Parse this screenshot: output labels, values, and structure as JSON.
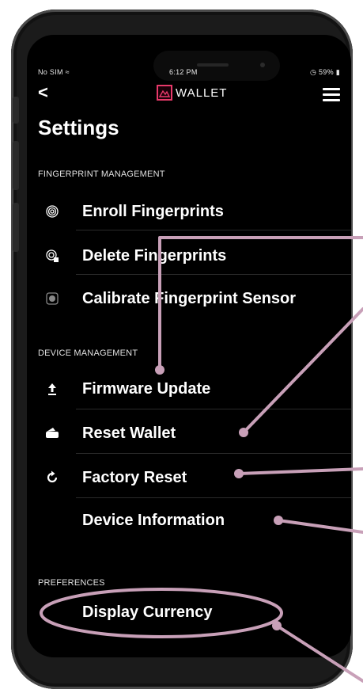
{
  "status": {
    "carrier": "No SIM",
    "wifi_icon": "wifi-icon",
    "time": "6:12 PM",
    "battery": "59%"
  },
  "header": {
    "back": "<",
    "brand": "WALLET",
    "logo_icon": "mountain-logo-icon",
    "menu_icon": "hamburger-menu-icon"
  },
  "page": {
    "title": "Settings"
  },
  "sections": {
    "fingerprint": {
      "label": "FINGERPRINT MANAGEMENT",
      "items": [
        {
          "label": "Enroll Fingerprints",
          "icon": "fingerprint-icon"
        },
        {
          "label": "Delete Fingerprints",
          "icon": "fingerprint-delete-icon"
        },
        {
          "label": "Calibrate Fingerprint Sensor",
          "icon": "sensor-icon"
        }
      ]
    },
    "device": {
      "label": "DEVICE MANAGEMENT",
      "items": [
        {
          "label": "Firmware Update",
          "icon": "upload-arrow-icon"
        },
        {
          "label": "Reset Wallet",
          "icon": "wallet-icon"
        },
        {
          "label": "Factory Reset",
          "icon": "refresh-icon"
        },
        {
          "label": "Device Information",
          "icon": ""
        }
      ]
    },
    "preferences": {
      "label": "PREFERENCES",
      "items": [
        {
          "label": "Display Currency",
          "icon": ""
        }
      ]
    }
  },
  "colors": {
    "background": "#000000",
    "text": "#ffffff",
    "annotation": "#c8a0b8",
    "brand": "#e8396a"
  }
}
